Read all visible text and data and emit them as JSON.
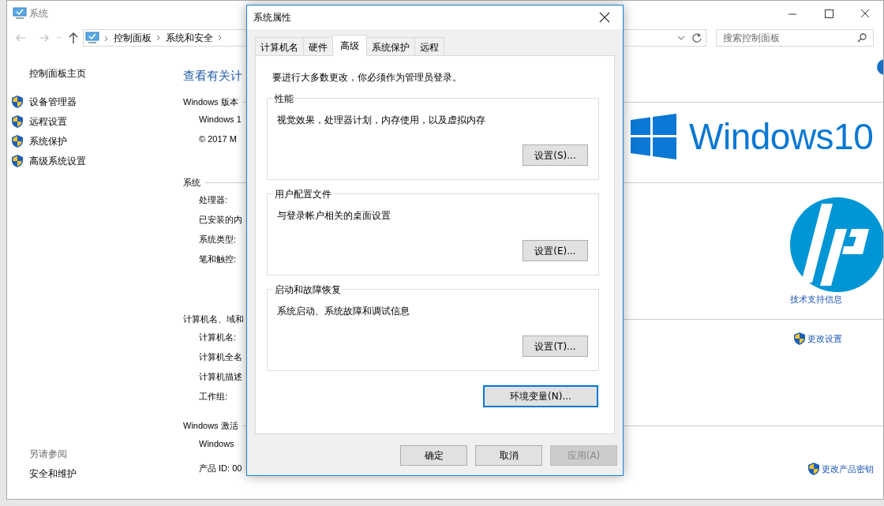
{
  "window": {
    "title": "系统"
  },
  "address_bar": {
    "breadcrumbs": [
      "控制面板",
      "系统和安全"
    ]
  },
  "search": {
    "placeholder": "搜索控制面板"
  },
  "sidebar": {
    "home": "控制面板主页",
    "items": [
      {
        "label": "设备管理器"
      },
      {
        "label": "远程设置"
      },
      {
        "label": "系统保护"
      },
      {
        "label": "高级系统设置"
      }
    ],
    "see_also_title": "另请参阅",
    "see_also": [
      "安全和维护"
    ]
  },
  "main": {
    "heading": "查看有关计",
    "sections": [
      {
        "title": "Windows 版本",
        "rows": [
          "Windows 1",
          "© 2017 M"
        ],
        "side": {
          "kind": "os-logo",
          "text": "Windows10"
        }
      },
      {
        "title": "系统",
        "rows": [
          "处理器:",
          "已安装的内",
          "系统类型:",
          "笔和触控:"
        ],
        "side": {
          "kind": "vendor-logo",
          "link": "技术支持信息"
        }
      },
      {
        "title": "计算机名、域和",
        "rows": [
          "计算机名:",
          "计算机全名",
          "计算机描述",
          "工作组:"
        ],
        "side": {
          "kind": "shield-link",
          "link": "更改设置"
        }
      },
      {
        "title": "Windows 激活",
        "rows": [
          "Windows",
          "产品 ID: 00"
        ],
        "side": {
          "kind": "shield-link",
          "link": "更改产品密钥"
        }
      }
    ]
  },
  "dialog": {
    "title": "系统属性",
    "tabs": [
      {
        "label": "计算机名",
        "selected": false
      },
      {
        "label": "硬件",
        "selected": false
      },
      {
        "label": "高级",
        "selected": true
      },
      {
        "label": "系统保护",
        "selected": false
      },
      {
        "label": "远程",
        "selected": false
      }
    ],
    "note": "要进行大多数更改，你必须作为管理员登录。",
    "groups": [
      {
        "title": "性能",
        "description": "视觉效果，处理器计划，内存使用，以及虚拟内存",
        "button": "设置(S)..."
      },
      {
        "title": "用户配置文件",
        "description": "与登录帐户相关的桌面设置",
        "button": "设置(E)..."
      },
      {
        "title": "启动和故障恢复",
        "description": "系统启动、系统故障和调试信息",
        "button": "设置(T)..."
      }
    ],
    "env_button": {
      "label": "环境变量(N)...",
      "focused": true
    },
    "buttons": [
      {
        "label": "确定",
        "disabled": false
      },
      {
        "label": "取消",
        "disabled": false
      },
      {
        "label": "应用(A)",
        "disabled": true
      }
    ]
  }
}
